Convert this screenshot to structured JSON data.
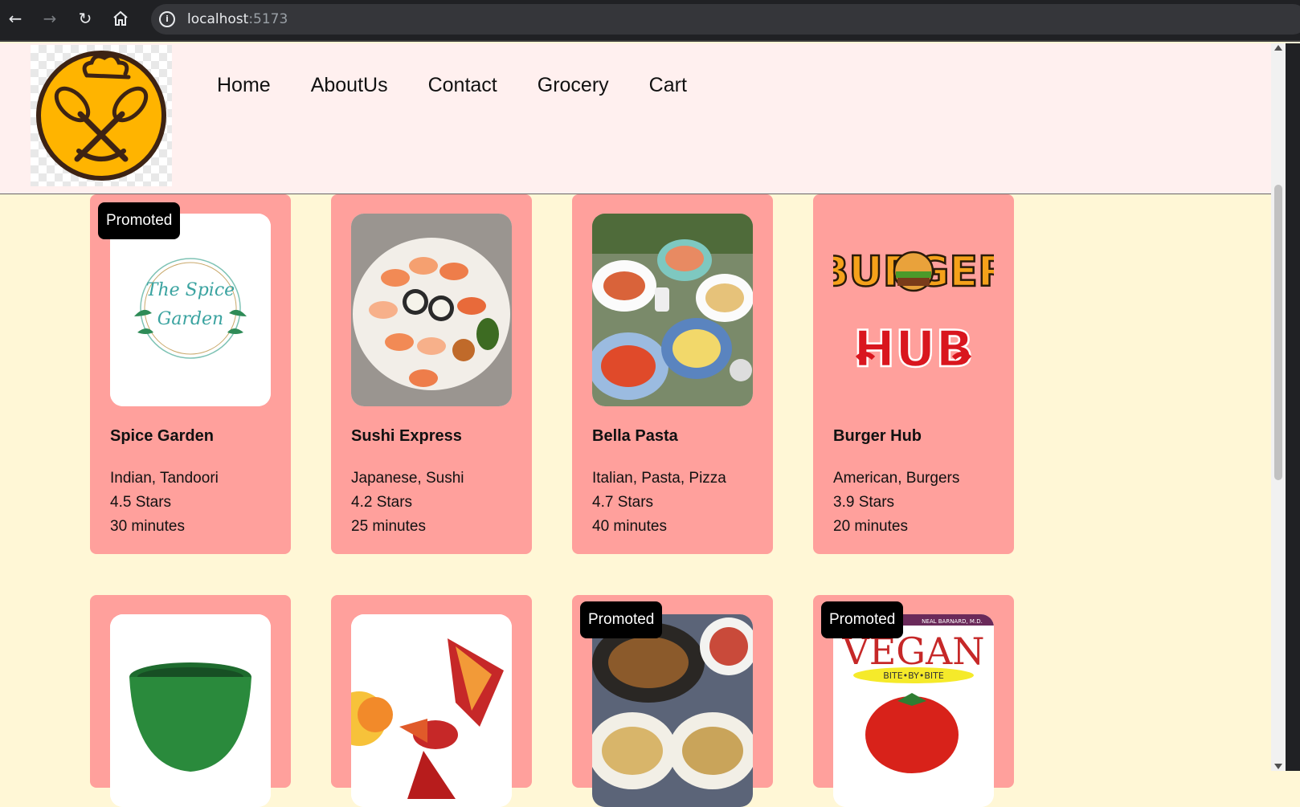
{
  "browser": {
    "url_host": "localhost",
    "url_port": ":5173"
  },
  "nav": {
    "items": [
      "Home",
      "AboutUs",
      "Contact",
      "Grocery",
      "Cart"
    ]
  },
  "badge_label": "Promoted",
  "restaurants": [
    {
      "name": "Spice Garden",
      "cuisine": "Indian, Tandoori",
      "rating": "4.5 Stars",
      "time": "30 minutes",
      "promoted": true,
      "logo_text": [
        "The Spice",
        "Garden"
      ]
    },
    {
      "name": "Sushi Express",
      "cuisine": "Japanese, Sushi",
      "rating": "4.2 Stars",
      "time": "25 minutes",
      "promoted": false
    },
    {
      "name": "Bella Pasta",
      "cuisine": "Italian, Pasta, Pizza",
      "rating": "4.7 Stars",
      "time": "40 minutes",
      "promoted": false
    },
    {
      "name": "Burger Hub",
      "cuisine": "American, Burgers",
      "rating": "3.9 Stars",
      "time": "20 minutes",
      "promoted": false,
      "logo_text": [
        "BURGER",
        "HUB"
      ]
    },
    {
      "promoted": false
    },
    {
      "promoted": false
    },
    {
      "promoted": true
    },
    {
      "promoted": true,
      "book_text": {
        "author": "NEAL BARNARD, M.D.",
        "title": "VEGAN",
        "subtitle": "BITE•BY•BITE"
      }
    }
  ],
  "colors": {
    "page_bg": "#fff7d6",
    "header_bg": "#fff0ef",
    "card_bg": "#ffa09c",
    "badge_bg": "#000000",
    "logo_yellow": "#ffb400"
  }
}
